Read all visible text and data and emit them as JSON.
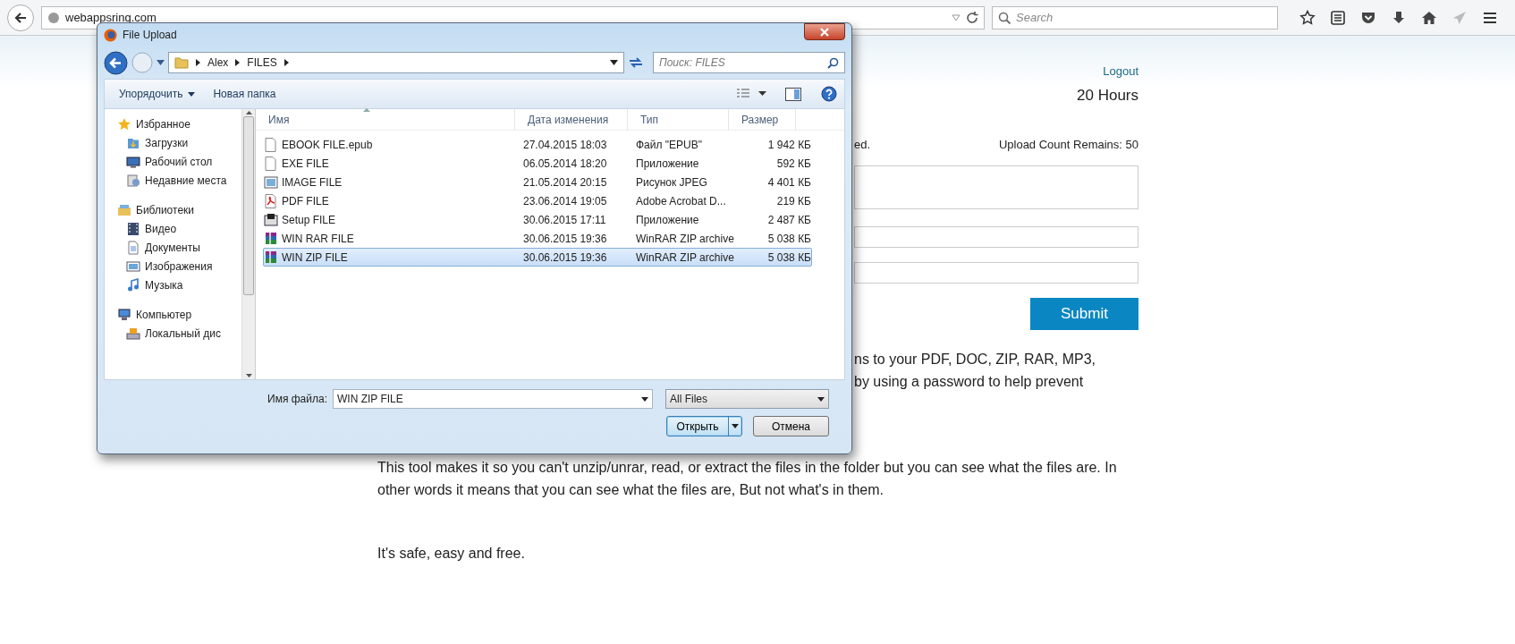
{
  "browser": {
    "url": "webappsring.com",
    "search_placeholder": "Search"
  },
  "page": {
    "logout": "Logout",
    "hours": "20 Hours",
    "notice_partial": "ed.",
    "upload_count": "Upload Count Remains: 50",
    "submit": "Submit",
    "paragraph_partial": [
      "ns to your PDF, DOC, ZIP, RAR, MP3,",
      "by using a password to help prevent"
    ],
    "paragraphs": [
      "This tool makes it so you can't unzip/unrar, read, or extract the files in the folder but you can see what the files are. In other words it means that you can see what the files are, But not what's in them.",
      "It's safe, easy and free."
    ]
  },
  "dialog": {
    "title": "File Upload",
    "breadcrumb": [
      "Alex",
      "FILES"
    ],
    "search_placeholder": "Поиск: FILES",
    "organize": "Упорядочить",
    "new_folder": "Новая папка",
    "nav": [
      {
        "label": "Избранное",
        "kind": "star",
        "children": [
          {
            "label": "Загрузки",
            "kind": "downloads"
          },
          {
            "label": "Рабочий стол",
            "kind": "desktop"
          },
          {
            "label": "Недавние места",
            "kind": "recent"
          }
        ]
      },
      {
        "label": "Библиотеки",
        "kind": "library",
        "children": [
          {
            "label": "Видео",
            "kind": "video"
          },
          {
            "label": "Документы",
            "kind": "document"
          },
          {
            "label": "Изображения",
            "kind": "image"
          },
          {
            "label": "Музыка",
            "kind": "music"
          }
        ]
      },
      {
        "label": "Компьютер",
        "kind": "computer",
        "children": [
          {
            "label": "Локальный дис",
            "kind": "disk"
          }
        ]
      }
    ],
    "columns": [
      "Имя",
      "Дата изменения",
      "Тип",
      "Размер"
    ],
    "files": [
      {
        "name": "EBOOK FILE.epub",
        "date": "27.04.2015 18:03",
        "type": "Файл \"EPUB\"",
        "size": "1 942 КБ",
        "kind": "blank",
        "selected": false
      },
      {
        "name": "EXE FILE",
        "date": "06.05.2014 18:20",
        "type": "Приложение",
        "size": "592 КБ",
        "kind": "blank",
        "selected": false
      },
      {
        "name": "IMAGE FILE",
        "date": "21.05.2014 20:15",
        "type": "Рисунок JPEG",
        "size": "4 401 КБ",
        "kind": "image",
        "selected": false
      },
      {
        "name": "PDF FILE",
        "date": "23.06.2014 19:05",
        "type": "Adobe Acrobat D...",
        "size": "219 КБ",
        "kind": "pdf",
        "selected": false
      },
      {
        "name": "Setup FILE",
        "date": "30.06.2015 17:11",
        "type": "Приложение",
        "size": "2 487 КБ",
        "kind": "setup",
        "selected": false
      },
      {
        "name": "WIN RAR FILE",
        "date": "30.06.2015 19:36",
        "type": "WinRAR ZIP archive",
        "size": "5 038 КБ",
        "kind": "archive",
        "selected": false
      },
      {
        "name": "WIN ZIP FILE",
        "date": "30.06.2015 19:36",
        "type": "WinRAR ZIP archive",
        "size": "5 038 КБ",
        "kind": "archive",
        "selected": true
      }
    ],
    "filename_label": "Имя файла:",
    "filename": "WIN ZIP FILE",
    "filter": "All Files",
    "open": "Открыть",
    "cancel": "Отмена"
  }
}
